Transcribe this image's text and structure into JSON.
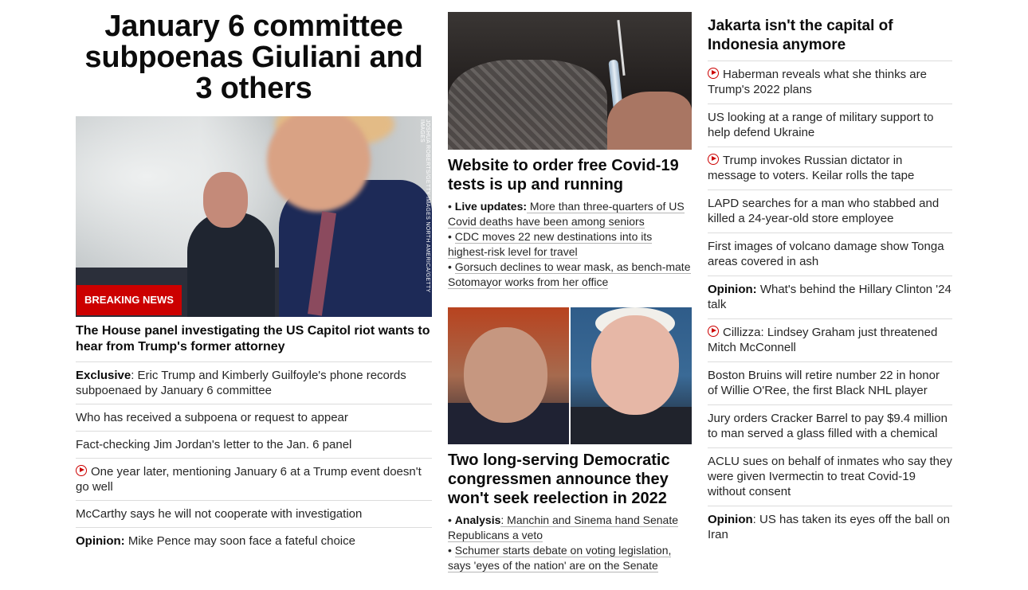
{
  "col1": {
    "headline": "January 6 committee subpoenas Giuliani and 3 others",
    "image_credit": "JOSHUA ROBERTS/GETTY IMAGES NORTH AMERICA/GETTY IMAGES",
    "badge": "BREAKING NEWS",
    "sub_headline": "The House panel investigating the US Capitol riot wants to hear from Trump's former attorney",
    "items": [
      {
        "prefix": "Exclusive",
        "text": ": Eric Trump and Kimberly Guilfoyle's phone records subpoenaed by January 6 committee",
        "video": false
      },
      {
        "prefix": "",
        "text": "Who has received a subpoena or request to appear",
        "video": false
      },
      {
        "prefix": "",
        "text": "Fact-checking Jim Jordan's letter to the Jan. 6 panel",
        "video": false
      },
      {
        "prefix": "",
        "text": "One year later, mentioning January 6 at a Trump event doesn't go well",
        "video": true
      },
      {
        "prefix": "",
        "text": "McCarthy says he will not cooperate with investigation",
        "video": false
      },
      {
        "prefix": "Opinion:",
        "text": " Mike Pence may soon face a fateful choice",
        "video": false
      }
    ]
  },
  "col2": {
    "card1": {
      "headline": "Website to order free Covid-19 tests is up and running",
      "bullets": [
        {
          "bold": "Live updates:",
          "text": " More than three-quarters of US Covid deaths have been among seniors"
        },
        {
          "bold": "",
          "text": "CDC moves 22 new destinations into its highest-risk level for travel"
        },
        {
          "bold": "",
          "text": "Gorsuch declines to wear mask, as bench-mate Sotomayor works from her office"
        }
      ]
    },
    "card2": {
      "headline": "Two long-serving Democratic congressmen announce they won't seek reelection in 2022",
      "bullets": [
        {
          "bold": "Analysis",
          "text": ": Manchin and Sinema hand Senate Republicans a veto"
        },
        {
          "bold": "",
          "text": "Schumer starts debate on voting legislation, says 'eyes of the nation' are on the Senate"
        }
      ]
    }
  },
  "col3": {
    "headline": "Jakarta isn't the capital of Indonesia anymore",
    "items": [
      {
        "prefix": "",
        "text": "Haberman reveals what she thinks are Trump's 2022 plans",
        "video": true
      },
      {
        "prefix": "",
        "text": "US looking at a range of military support to help defend Ukraine",
        "video": false
      },
      {
        "prefix": "",
        "text": "Trump invokes Russian dictator in message to voters. Keilar rolls the tape",
        "video": true
      },
      {
        "prefix": "",
        "text": "LAPD searches for a man who stabbed and killed a 24-year-old store employee",
        "video": false
      },
      {
        "prefix": "",
        "text": "First images of volcano damage show Tonga areas covered in ash",
        "video": false
      },
      {
        "prefix": "Opinion:",
        "text": " What's behind the Hillary Clinton '24 talk",
        "video": false
      },
      {
        "prefix": "",
        "text": "Cillizza: Lindsey Graham just threatened Mitch McConnell",
        "video": true
      },
      {
        "prefix": "",
        "text": "Boston Bruins will retire number 22 in honor of Willie O'Ree, the first Black NHL player",
        "video": false
      },
      {
        "prefix": "",
        "text": "Jury orders Cracker Barrel to pay $9.4 million to man served a glass filled with a chemical",
        "video": false
      },
      {
        "prefix": "",
        "text": "ACLU sues on behalf of inmates who say they were given Ivermectin to treat Covid-19 without consent",
        "video": false
      },
      {
        "prefix": "Opinion",
        "text": ": US has taken its eyes off the ball on Iran",
        "video": false
      }
    ]
  },
  "colors": {
    "accent": "#cc0000",
    "text": "#262626",
    "divider": "#dcdcdc"
  }
}
